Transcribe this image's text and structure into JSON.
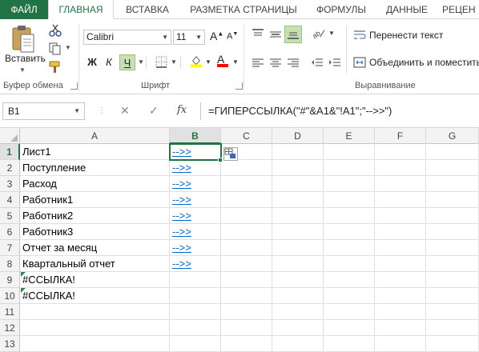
{
  "tabs": [
    {
      "label": "ФАЙЛ"
    },
    {
      "label": "ГЛАВНАЯ"
    },
    {
      "label": "ВСТАВКА"
    },
    {
      "label": "РАЗМЕТКА СТРАНИЦЫ"
    },
    {
      "label": "ФОРМУЛЫ"
    },
    {
      "label": "ДАННЫЕ"
    },
    {
      "label": "РЕЦЕН"
    }
  ],
  "ribbon": {
    "clipboard": {
      "group_label": "Буфер обмена",
      "paste_label": "Вставить"
    },
    "font": {
      "group_label": "Шрифт",
      "font_name": "Calibri",
      "font_size": "11",
      "grow_label": "A",
      "shrink_label": "A",
      "bold": "Ж",
      "italic": "К",
      "underline": "Ч",
      "font_color_letter": "A",
      "highlight_color": "#ffff00",
      "font_color": "#ff0000"
    },
    "alignment": {
      "group_label": "Выравнивание",
      "wrap_text": "Перенести текст",
      "merge_center": "Объединить и поместить"
    }
  },
  "formula_bar": {
    "name_box": "B1",
    "formula": "=ГИПЕРССЫЛКА(\"#\"&A1&\"!A1\";\"-->>\")"
  },
  "grid": {
    "columns": [
      "A",
      "B",
      "C",
      "D",
      "E",
      "F",
      "G"
    ],
    "selected_column": "B",
    "rows": [
      "1",
      "2",
      "3",
      "4",
      "5",
      "6",
      "7",
      "8",
      "9",
      "10",
      "11",
      "12",
      "13"
    ],
    "selected_row": "1",
    "cells": [
      {
        "a": "Лист1",
        "b": "-->>"
      },
      {
        "a": "Поступление",
        "b": "-->>"
      },
      {
        "a": "Расход",
        "b": "-->>"
      },
      {
        "a": "Работник1",
        "b": "-->>"
      },
      {
        "a": "Работник2",
        "b": "-->>"
      },
      {
        "a": "Работник3",
        "b": "-->>"
      },
      {
        "a": "Отчет за месяц",
        "b": "-->>"
      },
      {
        "a": "Квартальный отчет",
        "b": "-->>"
      },
      {
        "a": "#ССЫЛКА!",
        "b": ""
      },
      {
        "a": "#ССЫЛКА!",
        "b": ""
      }
    ],
    "accent_color": "#217346",
    "link_color": "#0563c1"
  }
}
